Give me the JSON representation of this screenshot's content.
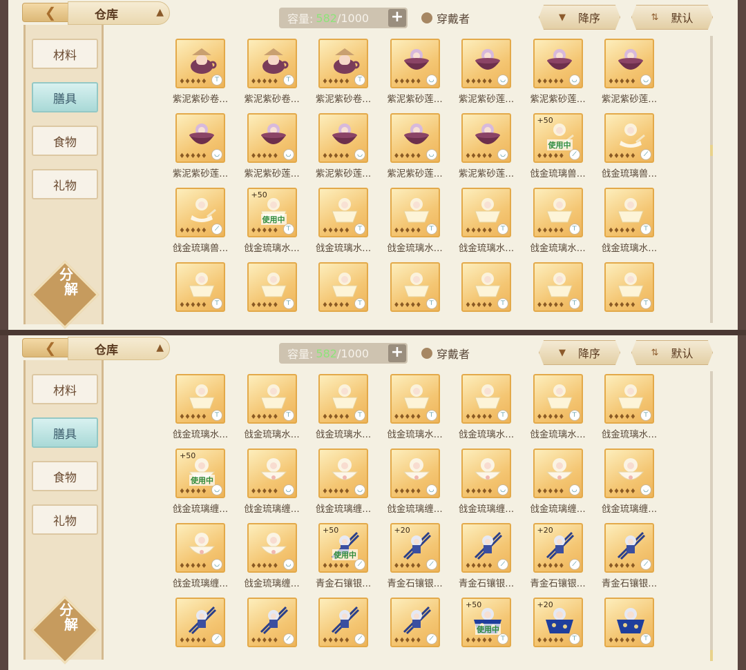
{
  "panels": [
    {
      "header": {
        "title": "仓库",
        "capacity_label": "容量:",
        "capacity_current": "582",
        "capacity_total": "/1000",
        "wearer_label": "穿戴者",
        "sort_order": "降序",
        "sort_mode": "默认"
      },
      "sidebar": {
        "items": [
          "材料",
          "膳具",
          "食物",
          "礼物"
        ],
        "active": 1,
        "decompose_top": "分",
        "decompose_bottom": "解"
      },
      "items": [
        {
          "name": "紫泥紫砂卷...",
          "art": "pot",
          "tag": "cup"
        },
        {
          "name": "紫泥紫砂卷...",
          "art": "pot",
          "tag": "cup"
        },
        {
          "name": "紫泥紫砂卷...",
          "art": "pot",
          "tag": "cup"
        },
        {
          "name": "紫泥紫砂莲...",
          "art": "bowl",
          "tag": "bowl"
        },
        {
          "name": "紫泥紫砂莲...",
          "art": "bowl",
          "tag": "bowl"
        },
        {
          "name": "紫泥紫砂莲...",
          "art": "bowl",
          "tag": "bowl"
        },
        {
          "name": "紫泥紫砂莲...",
          "art": "bowl",
          "tag": "bowl"
        },
        {
          "name": "紫泥紫砂莲...",
          "art": "bowl",
          "tag": "bowl"
        },
        {
          "name": "紫泥紫砂莲...",
          "art": "bowl",
          "tag": "bowl"
        },
        {
          "name": "紫泥紫砂莲...",
          "art": "bowl",
          "tag": "bowl"
        },
        {
          "name": "紫泥紫砂莲...",
          "art": "bowl",
          "tag": "bowl"
        },
        {
          "name": "紫泥紫砂莲...",
          "art": "bowl",
          "tag": "bowl"
        },
        {
          "name": "戗金琉璃兽...",
          "art": "spoon",
          "tag": "spoon",
          "bonus": "+50",
          "inuse": "使用中"
        },
        {
          "name": "戗金琉璃兽...",
          "art": "spoon",
          "tag": "spoon"
        },
        {
          "name": "戗金琉璃兽...",
          "art": "spoon",
          "tag": "spoon"
        },
        {
          "name": "戗金琉璃水...",
          "art": "glass",
          "tag": "cup",
          "bonus": "+50",
          "inuse": "使用中"
        },
        {
          "name": "戗金琉璃水...",
          "art": "glass",
          "tag": "cup"
        },
        {
          "name": "戗金琉璃水...",
          "art": "glass",
          "tag": "cup"
        },
        {
          "name": "戗金琉璃水...",
          "art": "glass",
          "tag": "cup"
        },
        {
          "name": "戗金琉璃水...",
          "art": "glass",
          "tag": "cup"
        },
        {
          "name": "戗金琉璃水...",
          "art": "glass",
          "tag": "cup"
        },
        {
          "name": "",
          "art": "glass",
          "tag": "cup"
        },
        {
          "name": "",
          "art": "glass",
          "tag": "cup"
        },
        {
          "name": "",
          "art": "glass",
          "tag": "cup"
        },
        {
          "name": "",
          "art": "glass",
          "tag": "cup"
        },
        {
          "name": "",
          "art": "glass",
          "tag": "cup"
        },
        {
          "name": "",
          "art": "glass",
          "tag": "cup"
        },
        {
          "name": "",
          "art": "glass",
          "tag": "cup"
        }
      ]
    },
    {
      "header": {
        "title": "仓库",
        "capacity_label": "容量:",
        "capacity_current": "582",
        "capacity_total": "/1000",
        "wearer_label": "穿戴者",
        "sort_order": "降序",
        "sort_mode": "默认"
      },
      "sidebar": {
        "items": [
          "材料",
          "膳具",
          "食物",
          "礼物"
        ],
        "active": 1,
        "decompose_top": "分",
        "decompose_bottom": "解"
      },
      "items": [
        {
          "name": "戗金琉璃水...",
          "art": "glass",
          "tag": "cup"
        },
        {
          "name": "戗金琉璃水...",
          "art": "glass",
          "tag": "cup"
        },
        {
          "name": "戗金琉璃水...",
          "art": "glass",
          "tag": "cup"
        },
        {
          "name": "戗金琉璃水...",
          "art": "glass",
          "tag": "cup"
        },
        {
          "name": "戗金琉璃水...",
          "art": "glass",
          "tag": "cup"
        },
        {
          "name": "戗金琉璃水...",
          "art": "glass",
          "tag": "cup"
        },
        {
          "name": "戗金琉璃水...",
          "art": "glass",
          "tag": "cup"
        },
        {
          "name": "戗金琉璃缠...",
          "art": "flower",
          "tag": "bowl",
          "bonus": "+50",
          "inuse": "使用中"
        },
        {
          "name": "戗金琉璃缠...",
          "art": "flower",
          "tag": "bowl"
        },
        {
          "name": "戗金琉璃缠...",
          "art": "flower",
          "tag": "bowl"
        },
        {
          "name": "戗金琉璃缠...",
          "art": "flower",
          "tag": "bowl"
        },
        {
          "name": "戗金琉璃缠...",
          "art": "flower",
          "tag": "bowl"
        },
        {
          "name": "戗金琉璃缠...",
          "art": "flower",
          "tag": "bowl"
        },
        {
          "name": "戗金琉璃缠...",
          "art": "flower",
          "tag": "bowl"
        },
        {
          "name": "戗金琉璃缠...",
          "art": "flower",
          "tag": "bowl"
        },
        {
          "name": "戗金琉璃缠...",
          "art": "flower",
          "tag": "bowl"
        },
        {
          "name": "青金石镶银...",
          "art": "chopsticks",
          "tag": "spoon",
          "bonus": "+50",
          "inuse": "使用中"
        },
        {
          "name": "青金石镶银...",
          "art": "chopsticks",
          "tag": "spoon",
          "bonus": "+20"
        },
        {
          "name": "青金石镶银...",
          "art": "chopsticks",
          "tag": "spoon"
        },
        {
          "name": "青金石镶银...",
          "art": "chopsticks",
          "tag": "spoon",
          "bonus": "+20"
        },
        {
          "name": "青金石镶银...",
          "art": "chopsticks",
          "tag": "spoon"
        },
        {
          "name": "",
          "art": "chopsticks",
          "tag": "spoon"
        },
        {
          "name": "",
          "art": "chopsticks",
          "tag": "spoon"
        },
        {
          "name": "",
          "art": "chopsticks",
          "tag": "spoon"
        },
        {
          "name": "",
          "art": "chopsticks",
          "tag": "spoon"
        },
        {
          "name": "",
          "art": "bluebowl",
          "tag": "cup",
          "bonus": "+50",
          "inuse": "使用中"
        },
        {
          "name": "",
          "art": "bluebowl",
          "tag": "cup",
          "bonus": "+20"
        },
        {
          "name": "",
          "art": "bluebowl",
          "tag": "cup"
        }
      ]
    }
  ],
  "stars": "♦♦♦♦♦",
  "colors": {
    "panel_bg": "#f4f0e2",
    "gold_border": "#e3a949",
    "active_tab": "#a9d9d7",
    "capacity_current": "#8ee37a"
  }
}
